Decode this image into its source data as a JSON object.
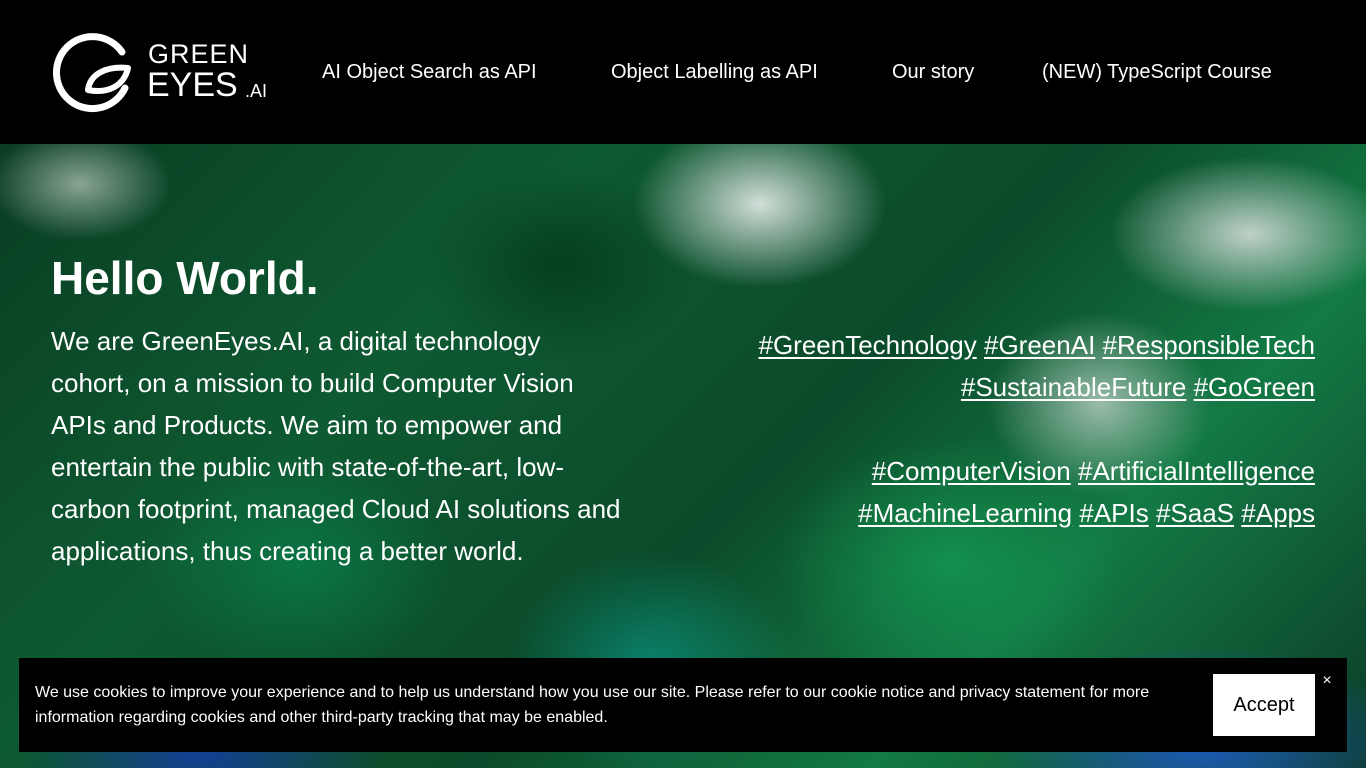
{
  "logo": {
    "line1": "GREEN",
    "line2": "EYES",
    "suffix": ".AI"
  },
  "nav": {
    "items": [
      {
        "label": "AI Object Search as API"
      },
      {
        "label": "Object Labelling as API"
      },
      {
        "label": "Our story"
      },
      {
        "label": "(NEW) TypeScript Course"
      }
    ]
  },
  "hero": {
    "title": "Hello World.",
    "description": "We are GreenEyes.AI, a digital technology cohort, on a mission to build Computer Vision APIs and Products. We aim to empower and entertain the public with state-of-the-art, low-carbon footprint, managed Cloud AI solutions and applications, thus creating a better world.",
    "tag_group_1": [
      "#GreenTechnology",
      "#GreenAI",
      "#ResponsibleTech",
      "#SustainableFuture",
      "#GoGreen"
    ],
    "tag_group_2": [
      "#ComputerVision",
      "#ArtificialIntelligence",
      "#MachineLearning",
      "#APIs",
      "#SaaS",
      "#Apps"
    ]
  },
  "cookie": {
    "text": "We use cookies to improve your experience and to help us understand how you use our site. Please refer to our cookie notice and privacy statement for more information regarding cookies and other third-party tracking that may be enabled.",
    "accept_label": "Accept",
    "close_label": "×"
  },
  "colors": {
    "header_bg": "#000000",
    "text": "#ffffff",
    "hero_green": "#0e5a32"
  },
  "icons": {
    "logo": "greeneyes-eye-leaf-icon"
  }
}
